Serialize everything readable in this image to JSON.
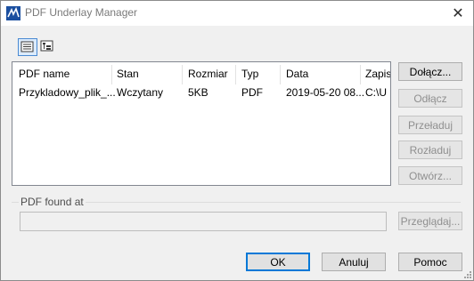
{
  "window": {
    "title": "PDF Underlay Manager",
    "close_glyph": "✕"
  },
  "toolbar": {
    "list_view_icon": "list-view-icon",
    "tree_view_icon": "tree-view-icon"
  },
  "list": {
    "columns": [
      "PDF name",
      "Stan",
      "Rozmiar",
      "Typ",
      "Data",
      "Zapis"
    ],
    "rows": [
      [
        "Przykladowy_plik_...",
        "Wczytany",
        "5KB",
        "PDF",
        "2019-05-20 08...",
        "C:\\U"
      ]
    ]
  },
  "side_buttons": {
    "attach": "Dołącz...",
    "detach": "Odłącz",
    "reload": "Przeładuj",
    "unload": "Rozładuj",
    "open": "Otwórz..."
  },
  "found_at": {
    "label": "PDF found at",
    "value": "",
    "browse": "Przeglądaj..."
  },
  "footer": {
    "ok": "OK",
    "cancel": "Anuluj",
    "help": "Pomoc"
  },
  "colors": {
    "accent": "#0078d7",
    "disabled_text": "#8f8f8f"
  }
}
